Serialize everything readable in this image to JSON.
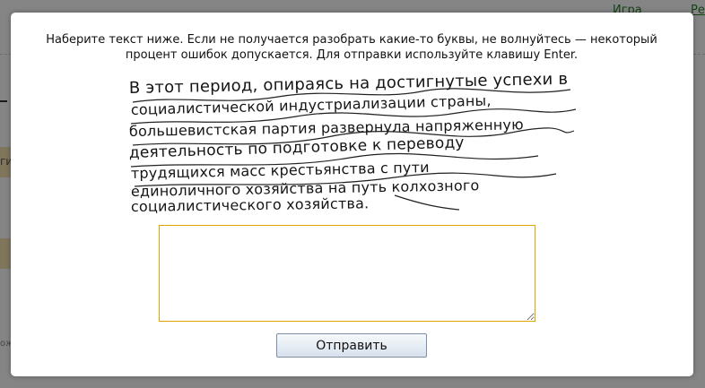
{
  "background": {
    "links": [
      "Игра",
      "Ре"
    ],
    "tab_text": "ги",
    "footer_text": "ож"
  },
  "modal": {
    "instructions": "Наберите текст ниже. Если не получается разобрать какие-то буквы, не волнуйтесь — некоторый процент ошибок допускается. Для отправки используйте клавишу Enter.",
    "captcha_lines": [
      "В этот период, опираясь на достигнутые успехи в",
      "социалистической индустриализации страны,",
      "большевистская партия развернула напряженную",
      "деятельность по подготовке к переводу",
      "трудящихся масс крестьянства с пути",
      "единоличного хозяйства на путь колхозного",
      "социалистического хозяйства."
    ],
    "answer_value": "",
    "submit_label": "Отправить"
  },
  "colors": {
    "input_border": "#e3a400",
    "link": "#2a7d2a"
  }
}
